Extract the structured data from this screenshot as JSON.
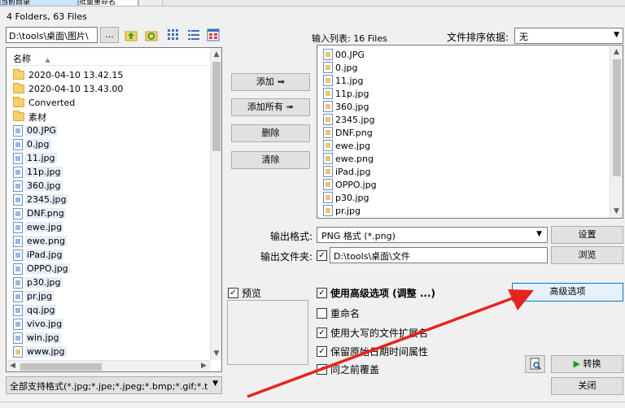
{
  "tabs": [
    {
      "label": "当前目录"
    },
    {
      "label": "批量重命名"
    },
    {
      "label": ""
    }
  ],
  "folder_count": "4 Folders, 63 Files",
  "path": "D:\\tools\\桌面\\图片\\",
  "browse_label": "...",
  "tree": {
    "column_header": "名称",
    "items": [
      {
        "label": "2020-04-10 13.42.15",
        "type": "folder"
      },
      {
        "label": "2020-04-10 13.43.00",
        "type": "folder"
      },
      {
        "label": "Converted",
        "type": "folder"
      },
      {
        "label": "素材",
        "type": "folder"
      },
      {
        "label": "00.JPG",
        "type": "image"
      },
      {
        "label": "0.jpg",
        "type": "image"
      },
      {
        "label": "11.jpg",
        "type": "image"
      },
      {
        "label": "11p.jpg",
        "type": "image"
      },
      {
        "label": "360.jpg",
        "type": "image"
      },
      {
        "label": "2345.jpg",
        "type": "image"
      },
      {
        "label": "DNF.png",
        "type": "image"
      },
      {
        "label": "ewe.jpg",
        "type": "image"
      },
      {
        "label": "ewe.png",
        "type": "image"
      },
      {
        "label": "iPad.jpg",
        "type": "image"
      },
      {
        "label": "OPPO.jpg",
        "type": "image"
      },
      {
        "label": "p30.jpg",
        "type": "image"
      },
      {
        "label": "pr.jpg",
        "type": "image"
      },
      {
        "label": "qq.jpg",
        "type": "image"
      },
      {
        "label": "vivo.jpg",
        "type": "image"
      },
      {
        "label": "win.jpg",
        "type": "image"
      },
      {
        "label": "www.jpg",
        "type": "image"
      }
    ]
  },
  "filter": "全部支持格式(*.jpg;*.jpe;*.jpeg;*.bmp;*.gif;*.t",
  "buttons": {
    "add": "添加",
    "add_all": "添加所有",
    "delete": "删除",
    "clear": "清除",
    "settings": "设置",
    "browse": "浏览",
    "advanced": "高级选项",
    "convert": "转换",
    "close": "关闭"
  },
  "input_list": {
    "label": "输入列表: 16 Files",
    "items": [
      "00.JPG",
      "0.jpg",
      "11.jpg",
      "11p.jpg",
      "360.jpg",
      "2345.jpg",
      "DNF.png",
      "ewe.jpg",
      "ewe.png",
      "iPad.jpg",
      "OPPO.jpg",
      "p30.jpg",
      "pr.jpg"
    ]
  },
  "sort": {
    "label": "文件排序依据:",
    "value": "无"
  },
  "output": {
    "format_label": "输出格式:",
    "format_value": "PNG 格式 (*.png)",
    "folder_label": "输出文件夹:",
    "folder_value": "D:\\tools\\桌面\\文件"
  },
  "preview_label": "预览",
  "options": {
    "use_advanced": "使用高级选项 (调整 ...)",
    "rename": "重命名",
    "uppercase_ext": "使用大写的文件扩展名",
    "keep_date": "保留原始日期时间属性",
    "overwrite": "同之前覆盖"
  },
  "colors": {
    "accent": "#0078d7",
    "arrow": "#e8231e"
  }
}
